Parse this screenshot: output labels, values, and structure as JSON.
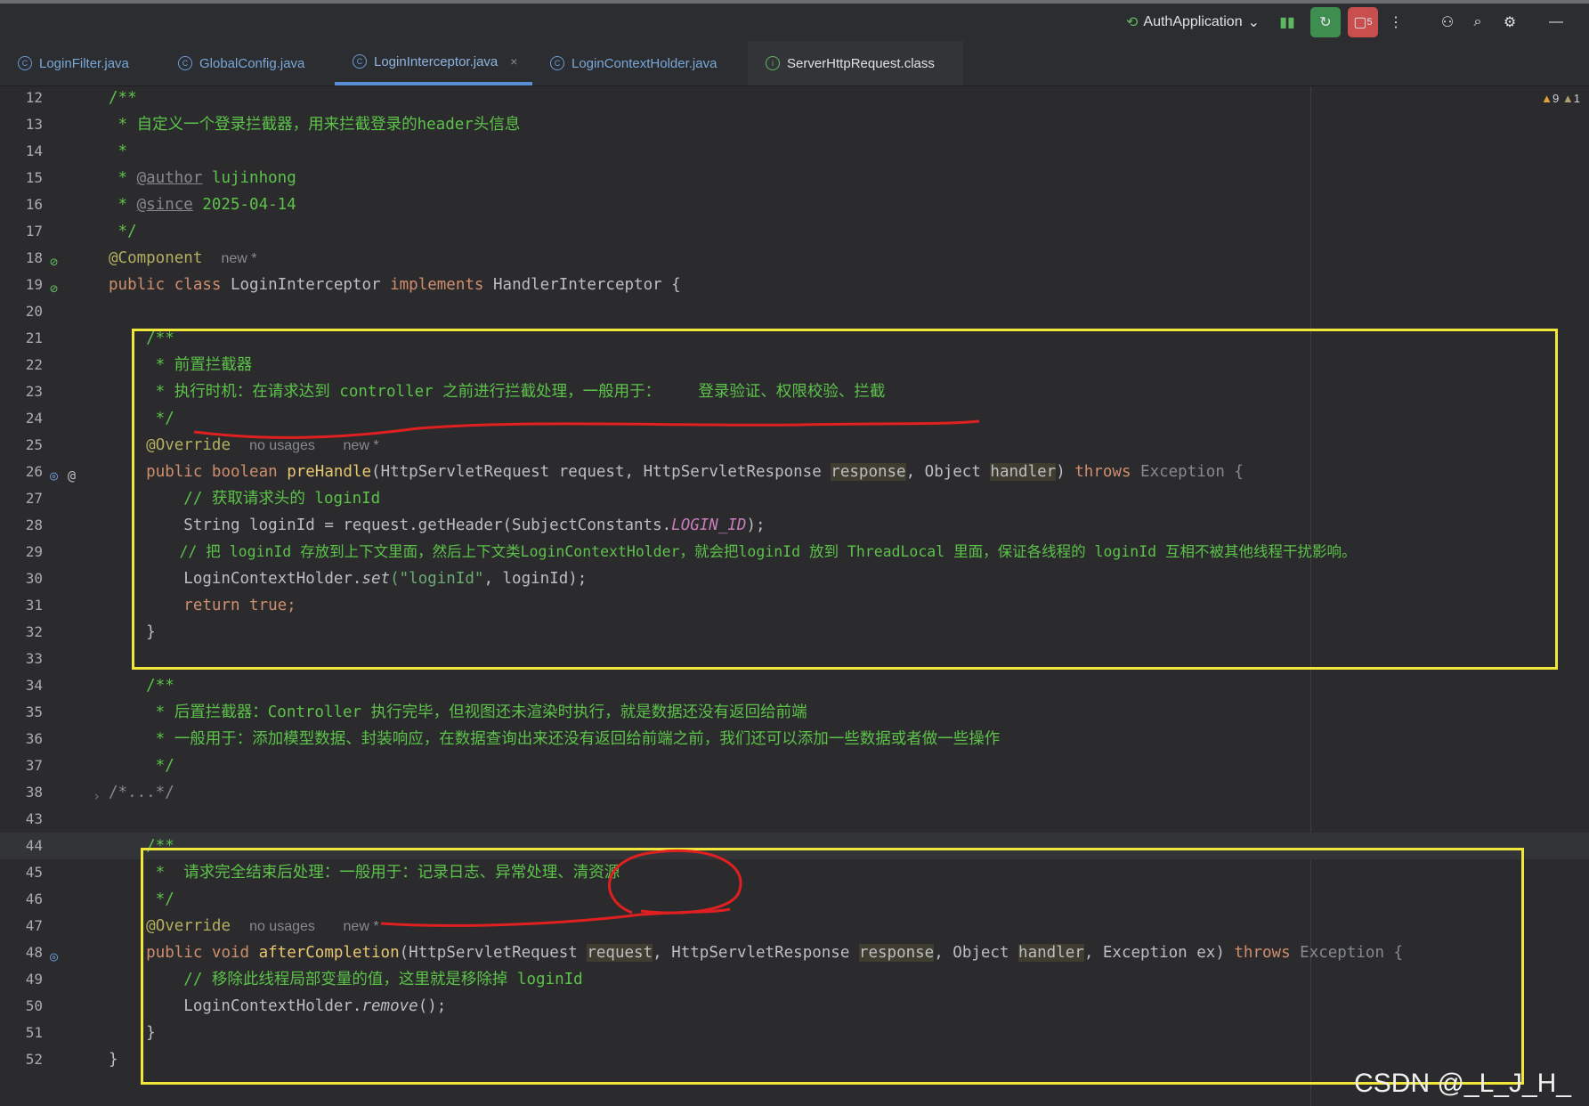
{
  "toolbar": {
    "run_config": "AuthApplication",
    "badge_count": "5"
  },
  "tabs": [
    {
      "label": "LoginFilter.java"
    },
    {
      "label": "GlobalConfig.java"
    },
    {
      "label": "LoginInterceptor.java"
    },
    {
      "label": "LoginContextHolder.java"
    },
    {
      "label": "ServerHttpRequest.class"
    }
  ],
  "inspections": {
    "warnings": "9",
    "weak_warnings": "1"
  },
  "lines": [
    {
      "n": "12",
      "text": "/**"
    },
    {
      "n": "13",
      "text": " * 自定义一个登录拦截器，用来拦截登录的header头信息"
    },
    {
      "n": "14",
      "text": " *"
    },
    {
      "n": "15",
      "tag": "@author",
      "rest": " lujinhong"
    },
    {
      "n": "16",
      "tag": "@since",
      "rest": " 2025-04-14"
    },
    {
      "n": "17",
      "text": " */"
    },
    {
      "n": "18",
      "annotation": "@Component",
      "hint": "new *"
    },
    {
      "n": "19",
      "kw1": "public class ",
      "cls": "LoginInterceptor ",
      "kw2": "implements ",
      "iface": "HandlerInterceptor {"
    },
    {
      "n": "20",
      "text": ""
    },
    {
      "n": "21",
      "text": "    /**"
    },
    {
      "n": "22",
      "text": "     * 前置拦截器"
    },
    {
      "n": "23",
      "text": "     * 执行时机：在请求达到 controller 之前进行拦截处理，一般用于：    登录验证、权限校验、拦截"
    },
    {
      "n": "24",
      "text": "     */"
    },
    {
      "n": "25",
      "annotation": "@Override",
      "hint1": "no usages",
      "hint2": "new *"
    },
    {
      "n": "26",
      "sig": {
        "kw": "public boolean ",
        "fn": "preHandle",
        "p1": "(HttpServletRequest request, HttpServletResponse ",
        "r": "response",
        "p2": ", Object ",
        "h": "handler",
        "p3": ") ",
        "th": "throws ",
        "ex": "Exception {"
      }
    },
    {
      "n": "27",
      "text": "        // 获取请求头的 loginId"
    },
    {
      "n": "28",
      "a": "        String loginId = request.getHeader(SubjectConstants.",
      "c": "LOGIN_ID",
      "b": ");"
    },
    {
      "n": "29",
      "text": "        // 把 loginId 存放到上下文里面，然后上下文类LoginContextHolder，就会把loginId 放到 ThreadLocal 里面，保证各线程的 loginId 互相不被其他线程干扰影响。"
    },
    {
      "n": "30",
      "a": "        LoginContextHolder.",
      "m": "set",
      "s": "(\"loginId\"",
      "b": ", loginId);"
    },
    {
      "n": "31",
      "kw": "        return true;"
    },
    {
      "n": "32",
      "text": "    }"
    },
    {
      "n": "33",
      "text": ""
    },
    {
      "n": "34",
      "text": "    /**"
    },
    {
      "n": "35",
      "text": "     * 后置拦截器：Controller 执行完毕，但视图还未渲染时执行，就是数据还没有返回给前端"
    },
    {
      "n": "36",
      "text": "     * 一般用于：添加模型数据、封装响应，在数据查询出来还没有返回给前端之前，我们还可以添加一些数据或者做一些操作"
    },
    {
      "n": "37",
      "text": "     */"
    },
    {
      "n": "38",
      "text": "/*...*/"
    },
    {
      "n": "43",
      "text": ""
    },
    {
      "n": "44",
      "text": "    /**"
    },
    {
      "n": "45",
      "text": "     *  请求完全结束后处理：一般用于：记录日志、异常处理、清资源"
    },
    {
      "n": "46",
      "text": "     */"
    },
    {
      "n": "47",
      "annotation": "@Override",
      "hint1": "no usages",
      "hint2": "new *"
    },
    {
      "n": "48",
      "sig": {
        "kw": "public void ",
        "fn": "afterCompletion",
        "p0": "(HttpServletRequest ",
        "q": "request",
        "p1": ", HttpServletResponse ",
        "r": "response",
        "p2": ", Object ",
        "h": "handler",
        "p3": ", Exception ex) ",
        "th": "throws ",
        "ex": "Exception {"
      }
    },
    {
      "n": "49",
      "text": "        // 移除此线程局部变量的值，这里就是移除掉 loginId"
    },
    {
      "n": "50",
      "a": "        LoginContextHolder.",
      "m": "remove",
      "b": "();"
    },
    {
      "n": "51",
      "text": "    }"
    },
    {
      "n": "52",
      "text": "}"
    }
  ],
  "watermark": "CSDN @_L_J_H_"
}
